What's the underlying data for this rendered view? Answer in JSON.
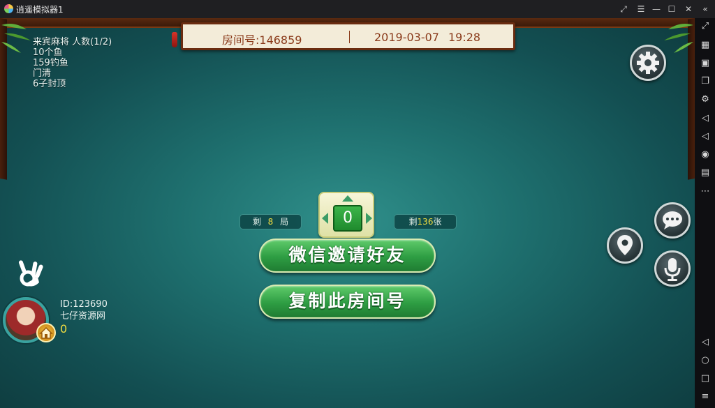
{
  "titlebar": {
    "title": "逍遥模拟器1",
    "controls": [
      "⤢",
      "☰",
      "—",
      "☐",
      "✕",
      "«"
    ]
  },
  "toolbar": {
    "items": [
      {
        "icon": "fullscreen-icon",
        "glyph": "⤢"
      },
      {
        "icon": "keyboard-icon",
        "glyph": "▦"
      },
      {
        "icon": "screenshot-icon",
        "glyph": "▣"
      },
      {
        "icon": "multi-window-icon",
        "glyph": "❐"
      },
      {
        "icon": "settings-icon",
        "glyph": "⚙"
      },
      {
        "icon": "volume-up-icon",
        "glyph": "◁"
      },
      {
        "icon": "volume-down-icon",
        "glyph": "◁"
      },
      {
        "icon": "location-icon",
        "glyph": "◉"
      },
      {
        "icon": "folder-icon",
        "glyph": "▤"
      },
      {
        "icon": "more-icon",
        "glyph": "⋯"
      },
      {
        "icon": "back-icon",
        "glyph": "◁"
      },
      {
        "icon": "home-icon",
        "glyph": "○"
      },
      {
        "icon": "recent-apps-icon",
        "glyph": "□"
      },
      {
        "icon": "menu-icon",
        "glyph": "≡"
      }
    ]
  },
  "header": {
    "room": "房间号:146859",
    "date": "2019-03-07",
    "time": "19:28"
  },
  "rules": {
    "lines": [
      "来宾麻将  人数(1/2)",
      "10个鱼",
      "159钓鱼",
      "门清",
      "6子封顶"
    ]
  },
  "compass": {
    "value": "0"
  },
  "rounds": {
    "prefix": "剩",
    "count": "8",
    "suffix": "局"
  },
  "tiles": {
    "prefix": "剩",
    "count": "136",
    "suffix": "张"
  },
  "buttons": {
    "invite": "微信邀请好友",
    "copy": "复制此房间号"
  },
  "player": {
    "id": "ID:123690",
    "name": "七仔资源网",
    "score": "0"
  },
  "colors": {
    "felt": "#1e6f6e",
    "button_green": "#2e9d43",
    "header_text": "#8a3a1a",
    "highlight": "#f2de41"
  }
}
